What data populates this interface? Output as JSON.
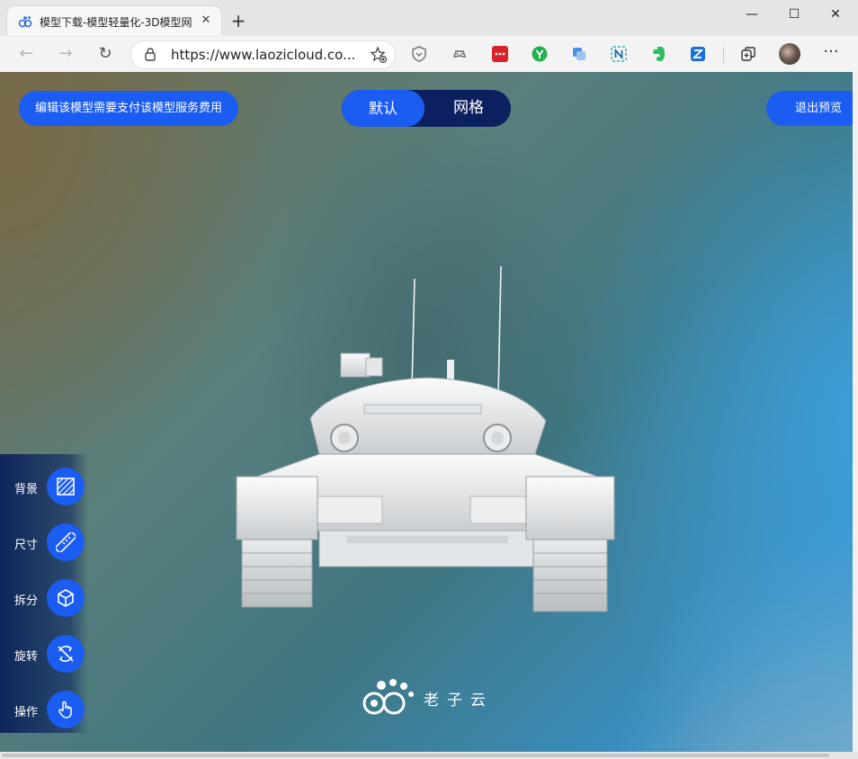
{
  "browser": {
    "tab_title": "模型下载-模型轻量化-3D模型网",
    "tab_close": "✕",
    "new_tab": "+",
    "url": "https://www.laozicloud.co...",
    "window": {
      "minimize": "—",
      "maximize": "☐",
      "close": "✕"
    },
    "more": "···"
  },
  "viewer": {
    "pay_button": "编辑该模型需要支付该模型服务费用",
    "mode_default": "默认",
    "mode_grid": "网格",
    "exit_button": "退出预览",
    "tools": [
      {
        "label": "背景",
        "icon": "background-icon"
      },
      {
        "label": "尺寸",
        "icon": "ruler-icon"
      },
      {
        "label": "拆分",
        "icon": "cube-icon"
      },
      {
        "label": "旋转",
        "icon": "rotate-icon"
      },
      {
        "label": "操作",
        "icon": "hand-icon"
      }
    ],
    "logo_text": "老子云"
  },
  "colors": {
    "accent": "#1b5cf2",
    "toggle_bg": "#0c2060"
  }
}
